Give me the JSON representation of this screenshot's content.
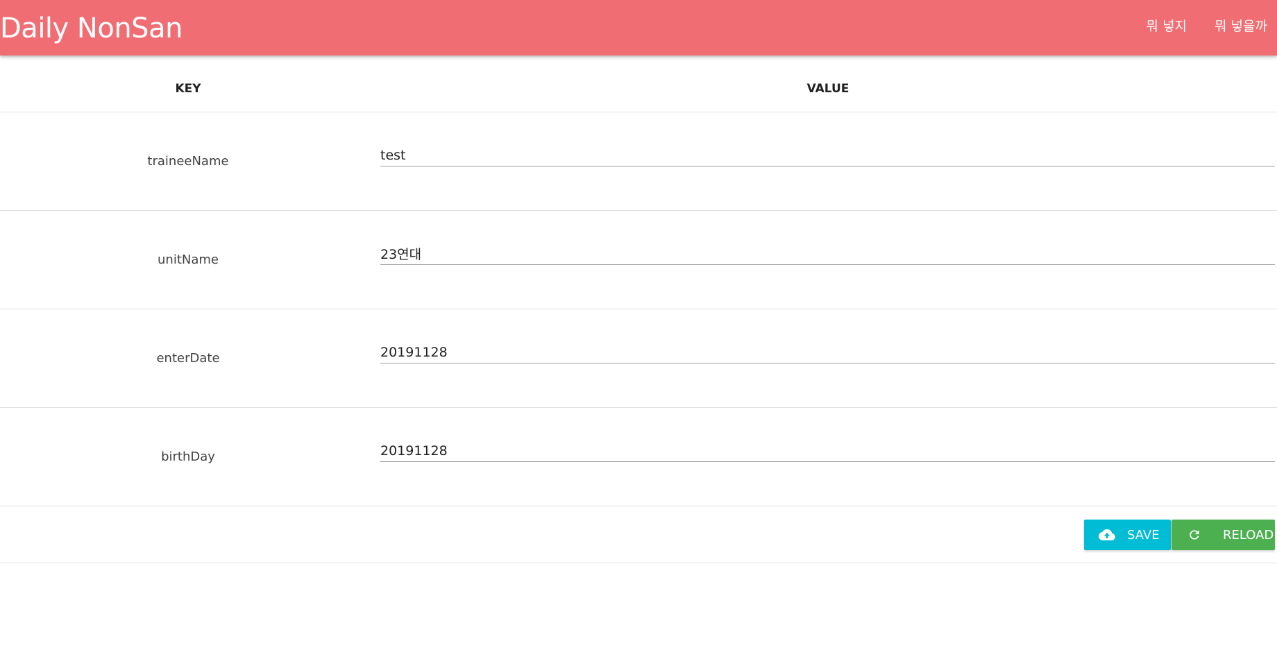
{
  "navbar": {
    "brand": "Daily NonSan",
    "links": [
      "뭐 넣지",
      "뭐 넣을까"
    ],
    "color": "#f06e73"
  },
  "table": {
    "headers": {
      "key": "KEY",
      "value": "VALUE"
    },
    "rows": [
      {
        "key": "traineeName",
        "value": "test"
      },
      {
        "key": "unitName",
        "value": "23연대"
      },
      {
        "key": "enterDate",
        "value": "20191128"
      },
      {
        "key": "birthDay",
        "value": "20191128"
      }
    ]
  },
  "actions": {
    "save_label": "SAVE",
    "save_icon": "cloud-upload-icon",
    "save_color": "#00bcd4",
    "reload_label": "RELOAD",
    "reload_icon": "refresh-icon",
    "reload_color": "#4caf50"
  }
}
